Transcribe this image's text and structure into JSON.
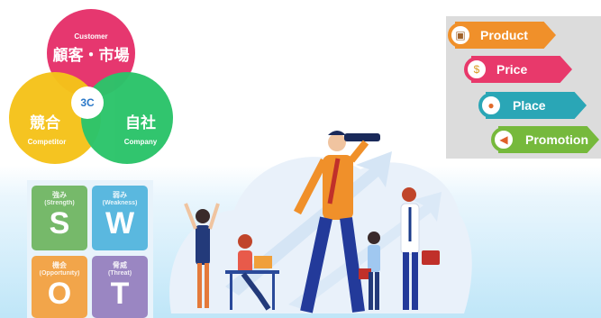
{
  "three_c": {
    "customer_en": "Customer",
    "customer_jp": "顧客・市場",
    "center": "3C",
    "competitor_jp": "競合",
    "competitor_en": "Competitor",
    "company_jp": "自社",
    "company_en": "Company"
  },
  "four_p": [
    {
      "label": "Product",
      "color": "#f0902a",
      "icon": "box-icon"
    },
    {
      "label": "Price",
      "color": "#e8396b",
      "icon": "coin-icon"
    },
    {
      "label": "Place",
      "color": "#2aa6b6",
      "icon": "location-pin-icon"
    },
    {
      "label": "Promotion",
      "color": "#76b93c",
      "icon": "megaphone-icon"
    }
  ],
  "swot": {
    "s": {
      "jp": "強み",
      "en": "(Strength)",
      "letter": "S",
      "color": "#76b96a"
    },
    "w": {
      "jp": "弱み",
      "en": "(Weakness)",
      "letter": "W",
      "color": "#5ab8df"
    },
    "o": {
      "jp": "機会",
      "en": "(Opportunity)",
      "letter": "O",
      "color": "#f2a54a"
    },
    "t": {
      "jp": "脅威",
      "en": "(Threat)",
      "letter": "T",
      "color": "#9a86c2"
    }
  }
}
